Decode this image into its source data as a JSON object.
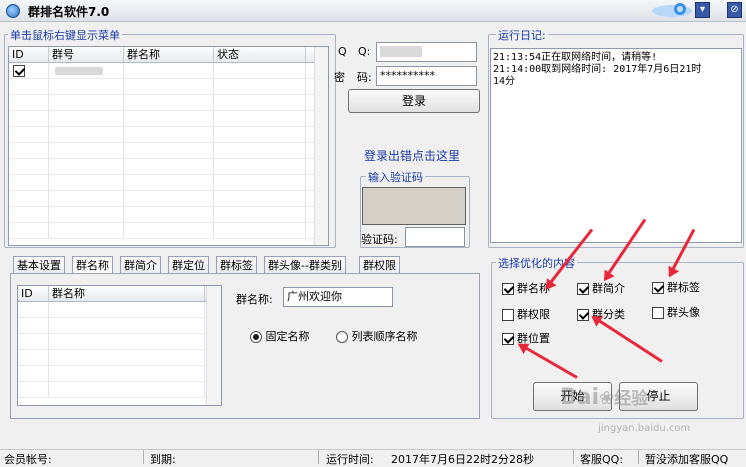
{
  "window": {
    "title": "群排名软件7.0",
    "dropdown_glyph": "▾",
    "close_glyph": "⊘"
  },
  "left_panel": {
    "title": "单击鼠标右键显示菜单",
    "columns": [
      "ID",
      "群号",
      "群名称",
      "状态"
    ]
  },
  "login": {
    "qq_label_prefix": "Q",
    "qq_label": "Q:",
    "qq_value": "",
    "pwd_label_prefix": "密",
    "pwd_label": "码:",
    "pwd_value": "**********",
    "login_button": "登录",
    "error_link": "登录出错点击这里",
    "captcha_group": "输入验证码",
    "captcha_label": "验证码:",
    "captcha_value": ""
  },
  "log": {
    "title": "运行日记:",
    "lines": [
      "21:13:54正在取网络时间，请稍等!",
      "21:14:00取到网络时间: 2017年7月6日21时",
      "14分"
    ]
  },
  "tabs": [
    "基本设置",
    "群名称",
    "群简介",
    "群定位",
    "群标签",
    "群头像--群类别",
    "群权限"
  ],
  "name_tab": {
    "columns": [
      "ID",
      "群名称"
    ],
    "name_label": "群名称:",
    "name_value": "广州欢迎你",
    "radio_fixed": "固定名称",
    "radio_list": "列表顺序名称"
  },
  "optimize": {
    "title": "选择优化的内容",
    "options": {
      "name": "群名称",
      "intro": "群简介",
      "tags": "群标签",
      "perm": "群权限",
      "category": "群分类",
      "avatar": "群头像",
      "location": "群位置"
    },
    "start_button": "开始",
    "stop_button": "停止"
  },
  "statusbar": {
    "member_label": "会员帐号:",
    "expire_label": "到期:",
    "runtime_label": "运行时间:",
    "runtime_value": "2017年7月6日22时2分28秒",
    "service_label": "客服QQ:",
    "service_value": "暂没添加客服QQ"
  },
  "watermark": {
    "brand": "Bai",
    "brand_suffix": "经验",
    "url": "jingyan.baidu.com"
  },
  "colors": {
    "group_title": "#1a3aa8",
    "annotation_arrow": "#e8283a",
    "link": "#1a3aa8"
  }
}
